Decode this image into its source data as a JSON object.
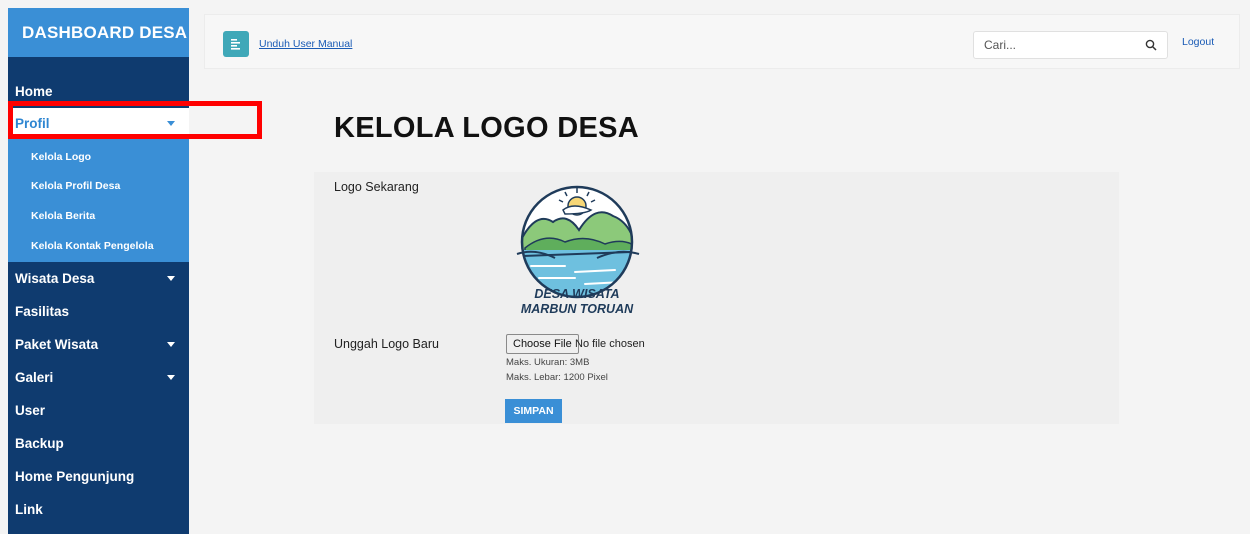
{
  "sidebar": {
    "brand": "DASHBOARD DESA",
    "items": [
      {
        "label": "Home"
      },
      {
        "label": "Profil"
      },
      {
        "label": "Wisata Desa"
      },
      {
        "label": "Fasilitas"
      },
      {
        "label": "Paket Wisata"
      },
      {
        "label": "Galeri"
      },
      {
        "label": "User"
      },
      {
        "label": "Backup"
      },
      {
        "label": "Home Pengunjung"
      },
      {
        "label": "Link"
      }
    ],
    "profil_sub": [
      {
        "label": "Kelola Logo"
      },
      {
        "label": "Kelola Profil Desa"
      },
      {
        "label": "Kelola Berita"
      },
      {
        "label": "Kelola Kontak Pengelola"
      }
    ]
  },
  "topbar": {
    "manual_link": "Unduh User Manual",
    "search_placeholder": "Cari...",
    "logout": "Logout"
  },
  "main": {
    "title": "KELOLA LOGO DESA",
    "current_logo_label": "Logo Sekarang",
    "logo_text_line1": "DESA WISATA",
    "logo_text_line2": "MARBUN TORUAN",
    "upload_label": "Unggah Logo Baru",
    "choose_file": "Choose File",
    "no_file": "No file chosen",
    "max_size": "Maks. Ukuran: 3MB",
    "max_width": "Maks. Lebar: 1200 Pixel",
    "save": "SIMPAN"
  },
  "colors": {
    "sidebar_bg": "#0f3b6f",
    "brand_bg": "#3a8fd6",
    "highlight": "#ff0000"
  }
}
